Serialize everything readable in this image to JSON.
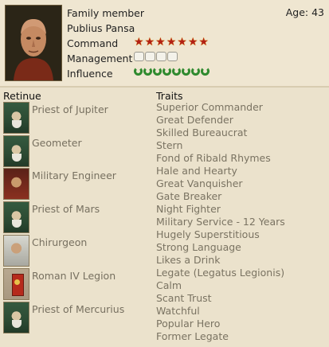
{
  "header": {
    "family_label": "Family member",
    "name": "Publius Pansa",
    "age": "Age: 43",
    "stats": [
      {
        "label": "Command",
        "icon": "star-icon",
        "count": 7
      },
      {
        "label": "Management",
        "icon": "scroll-icon",
        "count": 4
      },
      {
        "label": "Influence",
        "icon": "laurel-icon",
        "count": 8
      }
    ]
  },
  "retinue": {
    "title": "Retinue",
    "items": [
      {
        "label": "Priest of Jupiter",
        "icon": "priest-portrait"
      },
      {
        "label": "Geometer",
        "icon": "priest-portrait"
      },
      {
        "label": "Military Engineer",
        "icon": "engineer-portrait"
      },
      {
        "label": "Priest of Mars",
        "icon": "priest-portrait"
      },
      {
        "label": "Chirurgeon",
        "icon": "doctor-portrait"
      },
      {
        "label": "Roman IV Legion",
        "icon": "legion-standard"
      },
      {
        "label": "Priest of Mercurius",
        "icon": "priest-portrait"
      }
    ]
  },
  "traits": {
    "title": "Traits",
    "items": [
      "Superior Commander",
      "Great Defender",
      "Skilled Bureaucrat",
      "Stern",
      "Fond of Ribald Rhymes",
      "Hale and Hearty",
      "Great Vanquisher",
      "Gate Breaker",
      "Night Fighter",
      "Military Service - 12 Years",
      "Hugely Superstitious",
      "Strong Language",
      "Likes a Drink",
      "Legate (Legatus Legionis)",
      "Calm",
      "Scant Trust",
      "Watchful",
      "Popular Hero",
      "Former Legate"
    ]
  },
  "colors": {
    "background": "#ebe2cc",
    "star": "#b22015",
    "laurel": "#2f8a2e",
    "muted_text": "#7a7362"
  }
}
